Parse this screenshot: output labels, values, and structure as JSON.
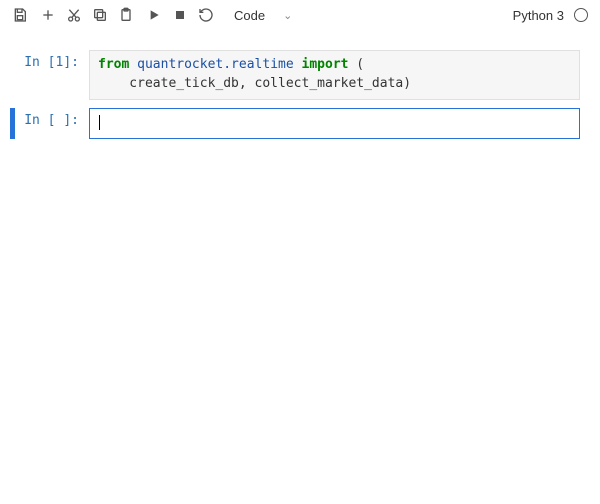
{
  "toolbar": {
    "mode_label": "Code"
  },
  "kernel": {
    "name": "Python 3"
  },
  "cells": [
    {
      "prompt": "In [1]:",
      "code_tokens": {
        "from": "from",
        "module": "quantrocket.realtime",
        "import": "import",
        "rest_line1": " (",
        "line2": "    create_tick_db, collect_market_data)"
      }
    },
    {
      "prompt": "In [ ]:",
      "code": ""
    }
  ]
}
